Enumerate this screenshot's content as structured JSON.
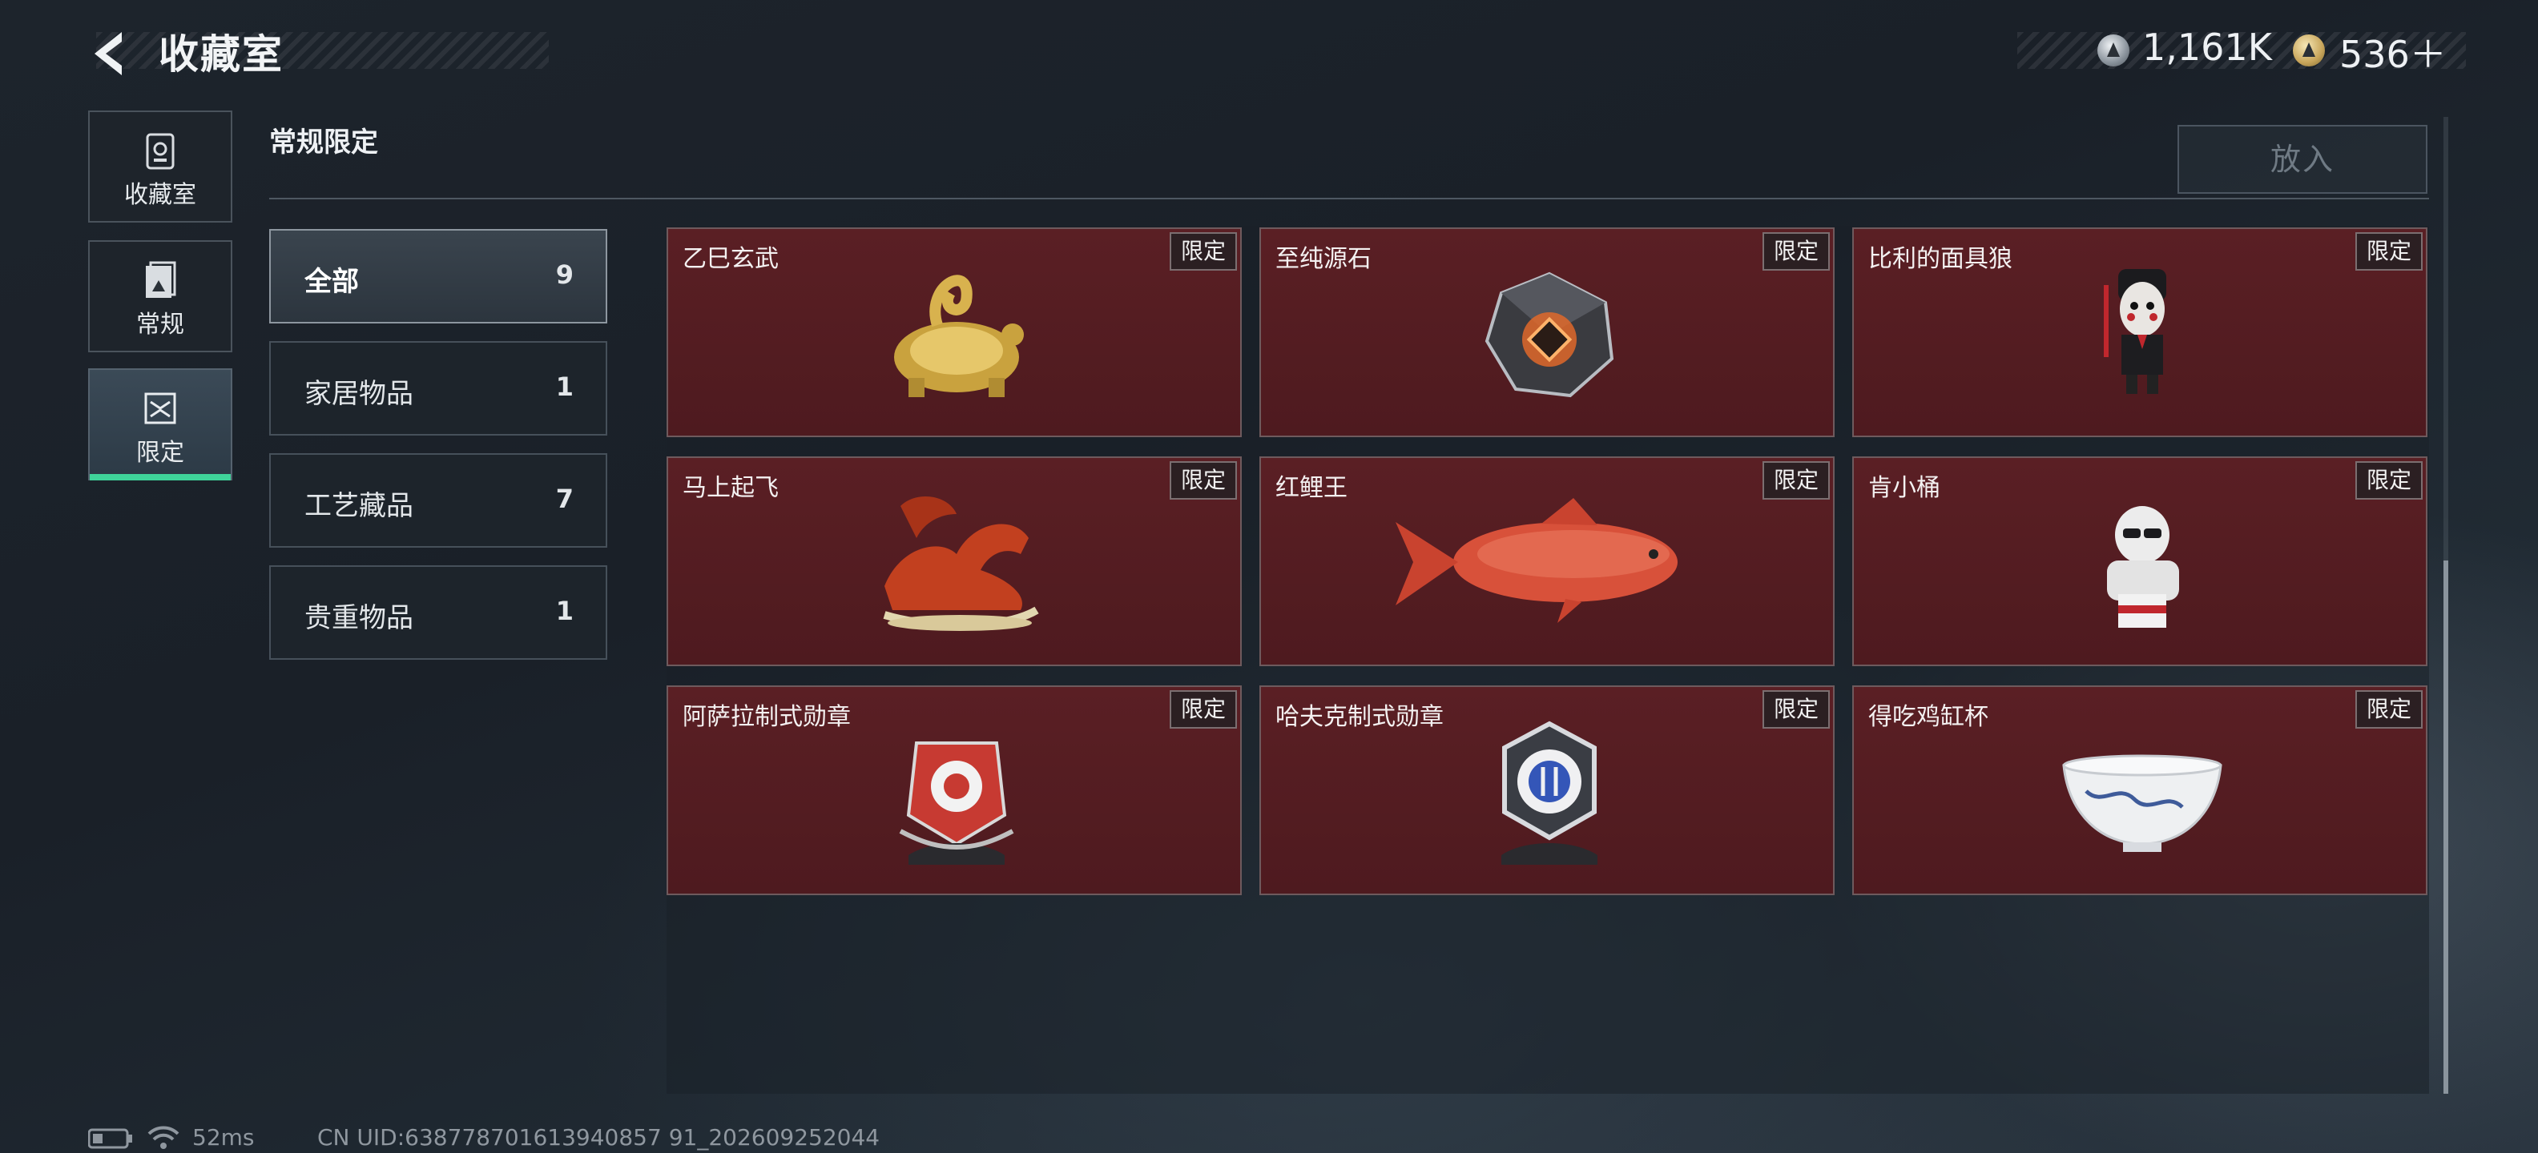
{
  "header": {
    "title": "收藏室",
    "currency": [
      {
        "icon": "silver-coin-icon",
        "value": "1,161K"
      },
      {
        "icon": "gold-coin-icon",
        "value": "536＋"
      }
    ]
  },
  "nav": [
    {
      "label": "收藏室",
      "icon": "collection-room-icon"
    },
    {
      "label": "常规",
      "icon": "regular-icon"
    },
    {
      "label": "限定",
      "icon": "limited-icon",
      "active": true
    }
  ],
  "section": {
    "title": "常规限定",
    "deposit_label": "放入"
  },
  "categories": [
    {
      "name": "全部",
      "count": "9"
    },
    {
      "name": "家居物品",
      "count": "1"
    },
    {
      "name": "工艺藏品",
      "count": "7"
    },
    {
      "name": "贵重物品",
      "count": "1"
    }
  ],
  "items": [
    {
      "name": "乙巳玄武",
      "tag": "限定",
      "icon": "golden-snake-turtle-icon"
    },
    {
      "name": "至纯源石",
      "tag": "限定",
      "icon": "source-stone-icon"
    },
    {
      "name": "比利的面具狼",
      "tag": "限定",
      "icon": "masked-doll-icon"
    },
    {
      "name": "马上起飞",
      "tag": "限定",
      "icon": "red-horse-icon"
    },
    {
      "name": "红鲤王",
      "tag": "限定",
      "icon": "red-carp-icon"
    },
    {
      "name": "肯小桶",
      "tag": "限定",
      "icon": "colonel-figurine-icon"
    },
    {
      "name": "阿萨拉制式勋章",
      "tag": "限定",
      "icon": "red-medal-icon"
    },
    {
      "name": "哈夫克制式勋章",
      "tag": "限定",
      "icon": "silver-medal-icon"
    },
    {
      "name": "得吃鸡缸杯",
      "tag": "限定",
      "icon": "porcelain-cup-icon"
    }
  ],
  "status": {
    "latency": "52ms",
    "uid": "CN UID:638778701613940857 91_202609252044"
  }
}
